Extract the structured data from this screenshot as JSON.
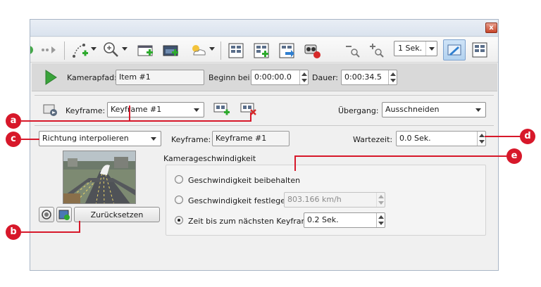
{
  "titlebar": {
    "close_label": "x"
  },
  "toolbar": {
    "interval_value": "1 Sek.",
    "icons": [
      "play-icon",
      "forward-icon",
      "path-add-icon",
      "zoom-in-icon",
      "screen-add-icon",
      "screen-tree-icon",
      "weather-icon",
      "grid-icon",
      "grid-add-icon",
      "grid-export-icon",
      "record-icon",
      "zoom-out-icon",
      "zoom-plus-icon",
      "camera-link-icon",
      "grid-view-icon"
    ]
  },
  "pathbar": {
    "kamerapfad_label": "Kamerapfad:",
    "kamerapfad_value": "Item #1",
    "beginn_label": "Beginn bei:",
    "beginn_value": "0:00:00.0",
    "dauer_label": "Dauer:",
    "dauer_value": "0:00:34.5"
  },
  "keyframe_row": {
    "label": "Keyframe:",
    "value": "Keyframe #1",
    "uebergang_label": "Übergang:",
    "uebergang_value": "Ausschneiden"
  },
  "interp_row": {
    "mode_value": "Richtung interpolieren",
    "keyframe_label": "Keyframe:",
    "keyframe_value": "Keyframe #1",
    "wartezeit_label": "Wartezeit:",
    "wartezeit_value": "0.0 Sek."
  },
  "speed": {
    "group_title": "Kamerageschwindigkeit",
    "options": [
      {
        "label": "Geschwindigkeit beibehalten",
        "selected": false
      },
      {
        "label": "Geschwindigkeit festlegen",
        "selected": false,
        "value": "803.166 km/h"
      },
      {
        "label": "Zeit bis zum nächsten Keyframe",
        "selected": true,
        "value": "0.2 Sek."
      }
    ]
  },
  "reset_button": "Zurücksetzen",
  "callouts": {
    "a": "a",
    "b": "b",
    "c": "c",
    "d": "d",
    "e": "e"
  },
  "colors": {
    "callout": "#d7182a",
    "play": "#3aa33b",
    "accent": "#2f7fd0"
  }
}
